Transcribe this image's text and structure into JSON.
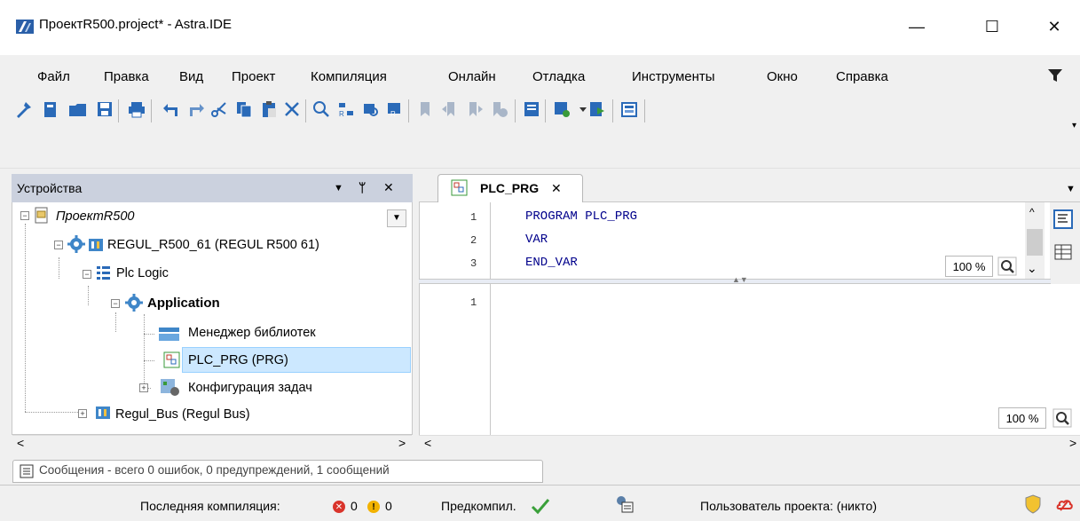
{
  "window": {
    "title": "ПроектR500.project* - Astra.IDE",
    "minimize": "—",
    "maximize": "☐",
    "close": "✕"
  },
  "menu": [
    "Файл",
    "Правка",
    "Вид",
    "Проект",
    "Компиляция",
    "Онлайн",
    "Отладка",
    "Инструменты",
    "Окно",
    "Справка"
  ],
  "devices": {
    "title": "Устройства",
    "tree": {
      "project": "ПроектR500",
      "device": "REGUL_R500_61 (REGUL R500 61)",
      "plc_logic": "Plc Logic",
      "application": "Application",
      "lib_manager": "Менеджер библиотек",
      "plc_prg": "PLC_PRG (PRG)",
      "task_config": "Конфигурация задач",
      "regul_bus": "Regul_Bus (Regul Bus)"
    }
  },
  "editor": {
    "tab_label": "PLC_PRG",
    "lines": [
      {
        "num": "1",
        "code": "PROGRAM PLC_PRG"
      },
      {
        "num": "2",
        "code": "VAR"
      },
      {
        "num": "3",
        "code": "END_VAR"
      }
    ],
    "bottom_line": "1",
    "zoom_top": "100 %",
    "zoom_bottom": "100 %"
  },
  "messages": {
    "label": "Сообщения - всего 0 ошибок, 0 предупреждений, 1 сообщений"
  },
  "status": {
    "last_compile": "Последняя компиляция:",
    "errors": "0",
    "warnings": "0",
    "precompile": "Предкомпил.",
    "project_user": "Пользователь проекта: (никто)"
  }
}
